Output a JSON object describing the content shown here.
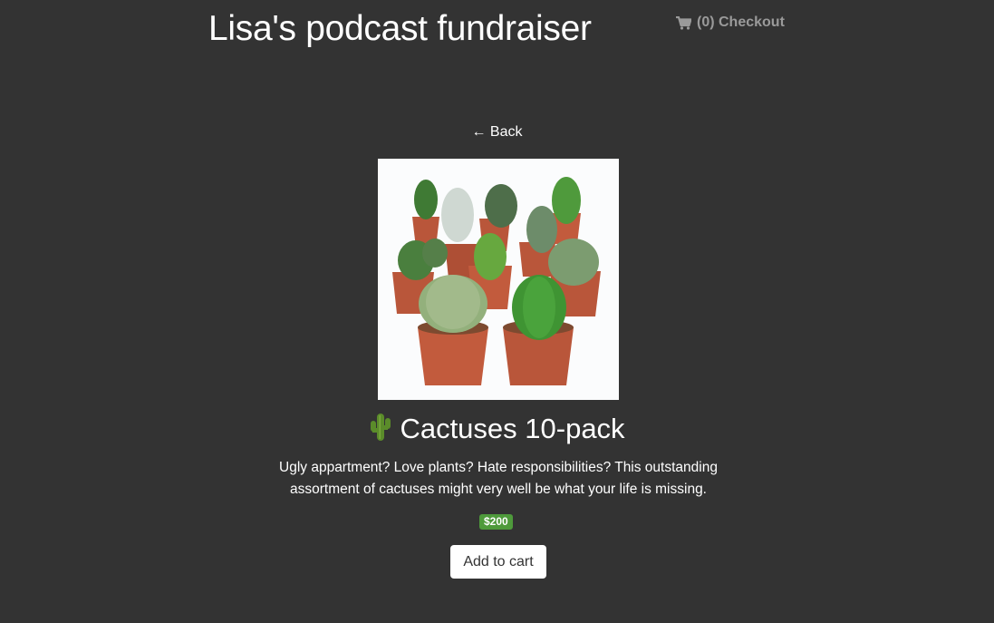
{
  "header": {
    "title": "Lisa's podcast fundraiser",
    "cart_icon": "shopping-cart-icon",
    "checkout_label": "(0) Checkout"
  },
  "nav": {
    "back_label": "← Back"
  },
  "product": {
    "title_icon": "cactus-emoji-icon",
    "title": "Cactuses 10-pack",
    "description": "Ugly appartment? Love plants? Hate responsibilities? This outstanding assortment of cactuses might very well be what your life is missing.",
    "price": "$200",
    "add_to_cart_label": "Add to cart"
  },
  "colors": {
    "background": "#333333",
    "price_badge": "#4e9a3b",
    "checkout_text": "#9a9a9a"
  }
}
